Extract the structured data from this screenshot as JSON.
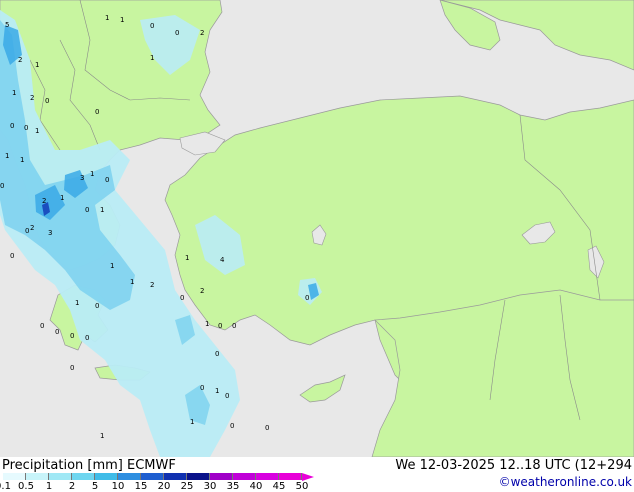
{
  "footer": {
    "title": "Precipitation [mm]  ECMWF",
    "datetime": "We 12-03-2025 12..18 UTC (12+294",
    "credit": "©weatheronline.co.uk"
  },
  "legend": {
    "ticks": [
      "0.1",
      "0.5",
      "1",
      "2",
      "5",
      "10",
      "15",
      "20",
      "25",
      "30",
      "35",
      "40",
      "45",
      "50"
    ],
    "colors": [
      "#e6fafe",
      "#c8f4fa",
      "#a0e8f5",
      "#6fd6f0",
      "#40bce8",
      "#2e8ee0",
      "#1e5ed0",
      "#1030b0",
      "#0a128a",
      "#a000c8",
      "#c000d8",
      "#d800e0",
      "#e800d8"
    ],
    "arrow_color": "#e800d8"
  },
  "map": {
    "sea_color": "#e8e8e8",
    "land_color": "#c8f5a0",
    "precip_light": "#b9ecf5",
    "precip_mid": "#7fd3ef",
    "precip_heavy": "#3aa9e6",
    "precip_core": "#1a4fc0",
    "labels": [
      "5",
      "1",
      "1",
      "0",
      "2",
      "1",
      "0",
      "2",
      "1",
      "2",
      "0",
      "1",
      "0",
      "0",
      "0",
      "1",
      "1",
      "1",
      "2",
      "1",
      "2",
      "0",
      "3",
      "3",
      "1",
      "0",
      "1",
      "0",
      "4",
      "1",
      "2",
      "1",
      "2",
      "1",
      "1",
      "0",
      "0",
      "0",
      "1",
      "0",
      "0",
      "0",
      "0",
      "0",
      "0",
      "0",
      "1",
      "0",
      "1",
      "0",
      "0",
      "1",
      "0",
      "0",
      "0",
      "0"
    ]
  }
}
